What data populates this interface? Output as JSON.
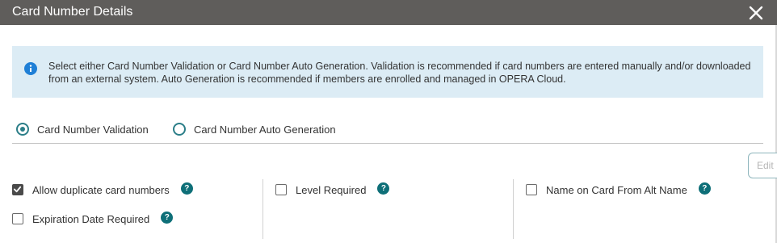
{
  "dialog": {
    "title": "Card Number Details",
    "close_icon": "close-icon"
  },
  "info": {
    "icon": "info-icon",
    "text": "Select either Card Number Validation or Card Number Auto Generation. Validation is recommended if card numbers are entered manually and/or downloaded from an external system. Auto Generation is recommended if members are enrolled and managed in OPERA Cloud."
  },
  "mode_options": [
    {
      "label": "Card Number Validation",
      "selected": true
    },
    {
      "label": "Card Number Auto Generation",
      "selected": false
    }
  ],
  "edit_label": "Edit",
  "options": {
    "allow_duplicate": {
      "label": "Allow duplicate card numbers",
      "checked": true
    },
    "expiration_date": {
      "label": "Expiration Date Required",
      "checked": false
    },
    "level_required": {
      "label": "Level Required",
      "checked": false
    },
    "name_on_card": {
      "label": "Name on Card From Alt Name",
      "checked": false
    }
  },
  "help_glyph": "?",
  "colors": {
    "titlebar": "#5f5d5b",
    "info_bg": "#dcecf5",
    "accent": "#2b7e88",
    "help": "#0e6f78"
  }
}
